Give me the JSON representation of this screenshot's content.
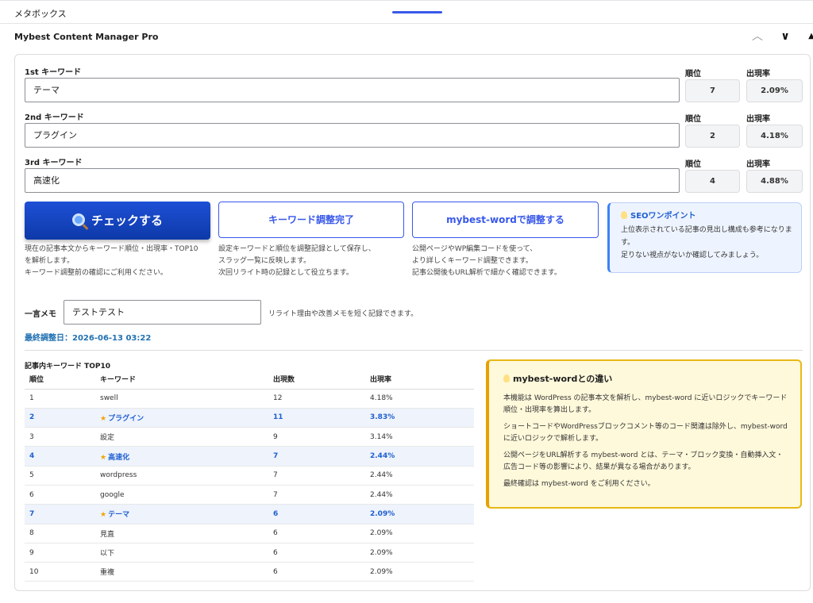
{
  "metabox": {
    "label": "メタボックス"
  },
  "panel": {
    "title": "Mybest Content Manager Pro"
  },
  "keywords": [
    {
      "label": "1st キーワード",
      "value": "テーマ",
      "rank_label": "順位",
      "rate_label": "出現率",
      "rank": "7",
      "rate": "2.09%"
    },
    {
      "label": "2nd キーワード",
      "value": "プラグイン",
      "rank_label": "順位",
      "rate_label": "出現率",
      "rank": "2",
      "rate": "4.18%"
    },
    {
      "label": "3rd キーワード",
      "value": "高速化",
      "rank_label": "順位",
      "rate_label": "出現率",
      "rank": "4",
      "rate": "4.88%"
    }
  ],
  "buttons": {
    "check": "チェックする",
    "kw_done": "キーワード調整完了",
    "mybest": "mybest-wordで調整する"
  },
  "descriptions": {
    "check": [
      "現在の記事本文からキーワード順位・出現率・TOP10",
      "を解析します。",
      "キーワード調整前の確認にご利用ください。"
    ],
    "kw_done": [
      "設定キーワードと順位を調整記録として保存し、",
      "スラッグ一覧に反映します。",
      "次回リライト時の記録として役立ちます。"
    ],
    "mybest": [
      "公開ページやWP編集コードを使って、",
      "より詳しくキーワード調整できます。",
      "記事公開後もURL解析で細かく確認できます。"
    ]
  },
  "seo": {
    "title": "SEOワンポイント",
    "body1": "上位表示されている記事の見出し構成も参考になります。",
    "body2": "足りない視点がないか確認してみましょう。"
  },
  "memo": {
    "label": "一言メモ",
    "value": "テストテスト",
    "hint": "リライト理由や改善メモを短く記録できます。",
    "last_adjusted": "最終調整日：2026-06-13 03:22"
  },
  "top10": {
    "title": "記事内キーワード TOP10",
    "headers": [
      "順位",
      "キーワード",
      "出現数",
      "出現率"
    ],
    "rows": [
      {
        "rank": "1",
        "kw": "swell",
        "count": "12",
        "rate": "4.18%",
        "hl": false
      },
      {
        "rank": "2",
        "kw": "プラグイン",
        "count": "11",
        "rate": "3.83%",
        "hl": true
      },
      {
        "rank": "3",
        "kw": "設定",
        "count": "9",
        "rate": "3.14%",
        "hl": false
      },
      {
        "rank": "4",
        "kw": "高速化",
        "count": "7",
        "rate": "2.44%",
        "hl": true
      },
      {
        "rank": "5",
        "kw": "wordpress",
        "count": "7",
        "rate": "2.44%",
        "hl": false
      },
      {
        "rank": "6",
        "kw": "google",
        "count": "7",
        "rate": "2.44%",
        "hl": false
      },
      {
        "rank": "7",
        "kw": "テーマ",
        "count": "6",
        "rate": "2.09%",
        "hl": true
      },
      {
        "rank": "8",
        "kw": "見直",
        "count": "6",
        "rate": "2.09%",
        "hl": false
      },
      {
        "rank": "9",
        "kw": "以下",
        "count": "6",
        "rate": "2.09%",
        "hl": false
      },
      {
        "rank": "10",
        "kw": "重複",
        "count": "6",
        "rate": "2.09%",
        "hl": false
      }
    ]
  },
  "diff": {
    "title": "mybest-wordとの違い",
    "p1": "本機能は WordPress の記事本文を解析し、mybest-word に近いロジックでキーワード順位・出現率を算出します。",
    "p2": "ショートコードやWordPressブロックコメント等のコード関連は除外し、mybest-wordに近いロジックで解析します。",
    "p3": "公開ページをURL解析する mybest-word とは、テーマ・ブロック変換・自動挿入文・広告コード等の影響により、結果が異なる場合があります。",
    "p4": "最終確認は mybest-word をご利用ください。"
  },
  "colors": {
    "accent": "#3858e9",
    "highlight_row": "#eef3fc",
    "warning_border": "#e8b817"
  }
}
